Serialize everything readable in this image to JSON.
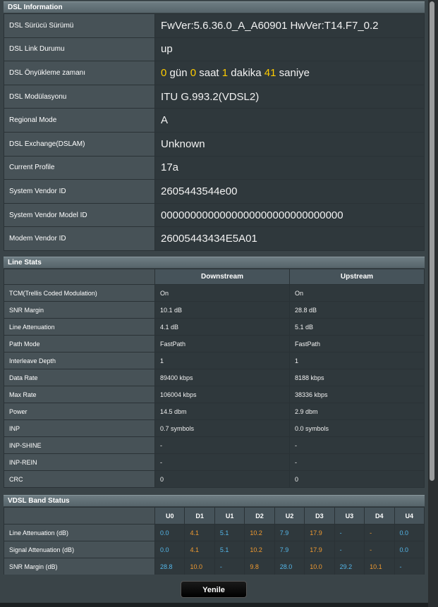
{
  "dsl_info": {
    "title": "DSL Information",
    "rows": [
      {
        "label": "DSL Sürücü Sürümü",
        "value": "FwVer:5.6.36.0_A_A60901 HwVer:T14.F7_0.2"
      },
      {
        "label": "DSL Link Durumu",
        "value": "up"
      },
      {
        "label": "DSL Önyükleme zamanı",
        "uptime": {
          "days": "0",
          "days_label": " gün ",
          "hours": "0",
          "hours_label": " saat ",
          "minutes": "1",
          "minutes_label": " dakika ",
          "seconds": "41",
          "seconds_label": " saniye"
        }
      },
      {
        "label": "DSL Modülasyonu",
        "value": "ITU G.993.2(VDSL2)"
      },
      {
        "label": "Regional Mode",
        "value": "A"
      },
      {
        "label": "DSL Exchange(DSLAM)",
        "value": "Unknown"
      },
      {
        "label": "Current Profile",
        "value": "17a"
      },
      {
        "label": "System Vendor ID",
        "value": "2605443544e00"
      },
      {
        "label": "System Vendor Model ID",
        "value": "0000000000000000000000000000000"
      },
      {
        "label": "Modem Vendor ID",
        "value": "26005443434E5A01"
      }
    ]
  },
  "line_stats": {
    "title": "Line Stats",
    "headers": [
      "Downstream",
      "Upstream"
    ],
    "rows": [
      {
        "label": "TCM(Trellis Coded Modulation)",
        "down": "On",
        "up": "On"
      },
      {
        "label": "SNR Margin",
        "down": "10.1 dB",
        "up": "28.8 dB"
      },
      {
        "label": "Line Attenuation",
        "down": "4.1 dB",
        "up": "5.1 dB"
      },
      {
        "label": "Path Mode",
        "down": "FastPath",
        "up": "FastPath"
      },
      {
        "label": "Interleave Depth",
        "down": "1",
        "up": "1"
      },
      {
        "label": "Data Rate",
        "down": "89400 kbps",
        "up": "8188 kbps"
      },
      {
        "label": "Max Rate",
        "down": "106004 kbps",
        "up": "38336 kbps"
      },
      {
        "label": "Power",
        "down": "14.5 dbm",
        "up": "2.9 dbm"
      },
      {
        "label": "INP",
        "down": "0.7 symbols",
        "up": "0.0 symbols"
      },
      {
        "label": "INP-SHINE",
        "down": "-",
        "up": "-"
      },
      {
        "label": "INP-REIN",
        "down": "-",
        "up": "-"
      },
      {
        "label": "CRC",
        "down": "0",
        "up": "0"
      }
    ]
  },
  "band_status": {
    "title": "VDSL Band Status",
    "bands": [
      "U0",
      "D1",
      "U1",
      "D2",
      "U2",
      "D3",
      "U3",
      "D4",
      "U4"
    ],
    "colors": {
      "upstream": "#54b6e8",
      "downstream": "#f09a30"
    },
    "rows": [
      {
        "label": "Line Attenuation (dB)",
        "values": [
          "0.0",
          "4.1",
          "5.1",
          "10.2",
          "7.9",
          "17.9",
          "-",
          "-",
          "0.0"
        ]
      },
      {
        "label": "Signal Attenuation (dB)",
        "values": [
          "0.0",
          "4.1",
          "5.1",
          "10.2",
          "7.9",
          "17.9",
          "-",
          "-",
          "0.0"
        ]
      },
      {
        "label": "SNR Margin (dB)",
        "values": [
          "28.8",
          "10.0",
          "-",
          "9.8",
          "28.0",
          "10.0",
          "29.2",
          "10.1",
          "-"
        ]
      }
    ]
  },
  "refresh_button": "Yenile"
}
